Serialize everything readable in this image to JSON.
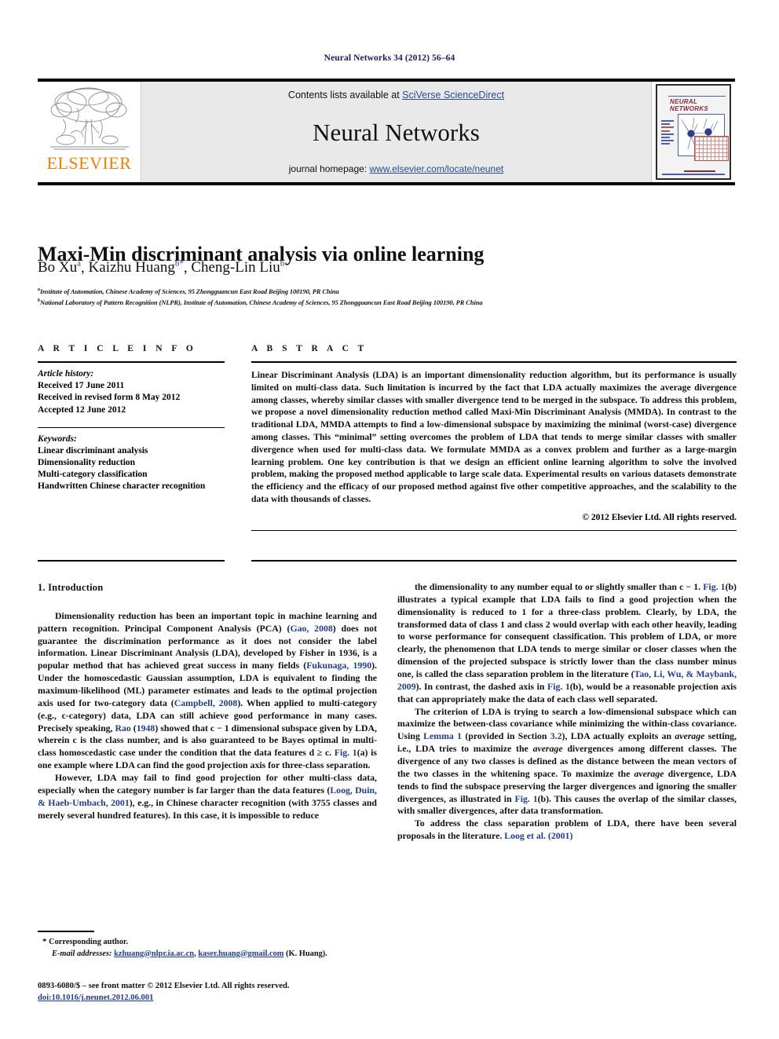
{
  "running_head": "Neural Networks 34 (2012) 56–64",
  "banner": {
    "publisher": "ELSEVIER",
    "contents_prefix": "Contents lists available at ",
    "contents_link": "SciVerse ScienceDirect",
    "journal_name": "Neural Networks",
    "homepage_prefix": "journal homepage: ",
    "homepage_url": "www.elsevier.com/locate/neunet",
    "cover_title_line1": "NEURAL",
    "cover_title_line2": "NETWORKS"
  },
  "article": {
    "title": "Maxi-Min discriminant analysis via online learning",
    "authors": [
      {
        "name": "Bo Xu",
        "sup": "a"
      },
      {
        "name": "Kaizhu Huang",
        "sup": "b",
        "star": "*"
      },
      {
        "name": "Cheng-Lin Liu",
        "sup": "b"
      }
    ],
    "affiliations": [
      {
        "label": "a",
        "text": "Institute of Automation, Chinese Academy of Sciences, 95 Zhongguancun East Road Beijing 100190, PR China"
      },
      {
        "label": "b",
        "text": "National Laboratory of Pattern Recognition (NLPR), Institute of Automation, Chinese Academy of Sciences, 95 Zhongguancun East Road Beijing 100190, PR China"
      }
    ]
  },
  "info": {
    "heading": "A R T I C L E   I N F O",
    "history_label": "Article history:",
    "history": [
      "Received 17 June 2011",
      "Received in revised form 8 May 2012",
      "Accepted 12 June 2012"
    ],
    "keywords_label": "Keywords:",
    "keywords": [
      "Linear discriminant analysis",
      "Dimensionality reduction",
      "Multi-category classification",
      "Handwritten Chinese character recognition"
    ]
  },
  "abstract": {
    "heading": "A B S T R A C T",
    "text": "Linear Discriminant Analysis (LDA) is an important dimensionality reduction algorithm, but its performance is usually limited on multi-class data. Such limitation is incurred by the fact that LDA actually maximizes the average divergence among classes, whereby similar classes with smaller divergence tend to be merged in the subspace. To address this problem, we propose a novel dimensionality reduction method called Maxi-Min Discriminant Analysis (MMDA). In contrast to the traditional LDA, MMDA attempts to find a low-dimensional subspace by maximizing the minimal (worst-case) divergence among classes. This “minimal” setting overcomes the problem of LDA that tends to merge similar classes with smaller divergence when used for multi-class data. We formulate MMDA as a convex problem and further as a large-margin learning problem. One key contribution is that we design an efficient online learning algorithm to solve the involved problem, making the proposed method applicable to large scale data. Experimental results on various datasets demonstrate the efficiency and the efficacy of our proposed method against five other competitive approaches, and the scalability to the data with thousands of classes.",
    "copyright": "© 2012 Elsevier Ltd. All rights reserved."
  },
  "section": {
    "number_title": "1. Introduction"
  },
  "body": {
    "left": [
      "Dimensionality reduction has been an important topic in machine learning and pattern recognition. Principal Component Analysis (PCA) (Gao, 2008) does not guarantee the discrimination performance as it does not consider the label information. Linear Discriminant Analysis (LDA), developed by Fisher in 1936, is a popular method that has achieved great success in many fields (Fukunaga, 1990). Under the homoscedastic Gaussian assumption, LDA is equivalent to finding the maximum-likelihood (ML) parameter estimates and leads to the optimal projection axis used for two-category data (Campbell, 2008). When applied to multi-category (e.g., c-category) data, LDA can still achieve good performance in many cases. Precisely speaking, Rao (1948) showed that c − 1 dimensional subspace given by LDA, wherein c is the class number, and is also guaranteed to be Bayes optimal in multi-class homoscedastic case under the condition that the data features d ≥ c. Fig. 1(a) is one example where LDA can find the good projection axis for three-class separation.",
      "However, LDA may fail to find good projection for other multi-class data, especially when the category number is far larger than the data features (Loog, Duin, & Haeb-Umbach, 2001), e.g., in Chinese character recognition (with 3755 classes and merely several hundred features). In this case, it is impossible to reduce"
    ],
    "right": [
      "the dimensionality to any number equal to or slightly smaller than c − 1. Fig. 1(b) illustrates a typical example that LDA fails to find a good projection when the dimensionality is reduced to 1 for a three-class problem. Clearly, by LDA, the transformed data of class 1 and class 2 would overlap with each other heavily, leading to worse performance for consequent classification. This problem of LDA, or more clearly, the phenomenon that LDA tends to merge similar or closer classes when the dimension of the projected subspace is strictly lower than the class number minus one, is called the class separation problem in the literature (Tao, Li, Wu, & Maybank, 2009). In contrast, the dashed axis in Fig. 1(b), would be a reasonable projection axis that can appropriately make the data of each class well separated.",
      "The criterion of LDA is trying to search a low-dimensional subspace which can maximize the between-class covariance while minimizing the within-class covariance. Using Lemma 1 (provided in Section 3.2), LDA actually exploits an average setting, i.e., LDA tries to maximize the average divergences among different classes. The divergence of any two classes is defined as the distance between the mean vectors of the two classes in the whitening space. To maximize the average divergence, LDA tends to find the subspace preserving the larger divergences and ignoring the smaller divergences, as illustrated in Fig. 1(b). This causes the overlap of the similar classes, with smaller divergences, after data transformation.",
      "To address the class separation problem of LDA, there have been several proposals in the literature. Loog et al. (2001)"
    ]
  },
  "footnote": {
    "star": "*",
    "corresponding": "Corresponding author.",
    "email_label": "E-mail addresses:",
    "email_1": "kzhuang@nlpr.ia.ac.cn",
    "email_sep": ", ",
    "email_2": "kaser.huang@gmail.com",
    "email_owner": " (K. Huang)."
  },
  "imprint": {
    "line1": "0893-6080/$ – see front matter © 2012 Elsevier Ltd. All rights reserved.",
    "doi": "doi:10.1016/j.neunet.2012.06.001"
  },
  "colors": {
    "link_blue": "#2a4b9b",
    "ref_blue": "#1f3d8f",
    "elsevier_orange": "#f08000",
    "banner_grey": "#e9e9e9"
  }
}
